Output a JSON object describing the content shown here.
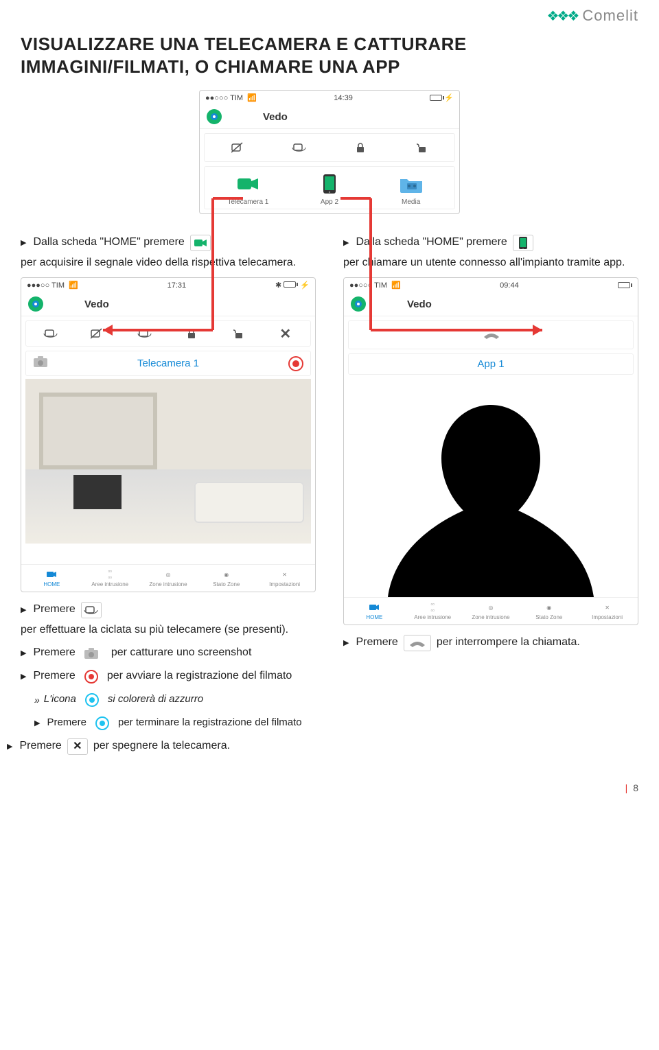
{
  "brand": "Comelit",
  "section_title": "VISUALIZZARE UNA TELECAMERA E CATTURARE IMMAGINI/FILMATI, O CHIAMARE UNA APP",
  "top_phone": {
    "carrier": "TIM",
    "time": "14:39",
    "title": "Vedo",
    "items": [
      "Telecamera 1",
      "App 2",
      "Media"
    ]
  },
  "left": {
    "intro_parts": [
      "Dalla scheda \"HOME\" premere",
      "per acquisire il segnale video della rispettiva telecamera."
    ],
    "phone": {
      "carrier": "TIM",
      "time": "17:31",
      "title": "Vedo",
      "cam_name": "Telecamera 1",
      "nav": [
        "HOME",
        "Aree intrusione",
        "Zone intrusione",
        "Stato Zone",
        "Impostazioni"
      ]
    },
    "bullet1": [
      "Premere",
      "per effettuare la ciclata su più telecamere (se presenti)."
    ],
    "bullet2": [
      "Premere",
      "per catturare uno screenshot"
    ],
    "bullet3": [
      "Premere",
      "per avviare la registrazione del filmato"
    ],
    "sub1": [
      "L'icona",
      "si colorerà di azzurro"
    ],
    "sub2": [
      "Premere",
      "per terminare la registrazione del filmato"
    ],
    "bullet4": [
      "Premere",
      "per spegnere la telecamera."
    ]
  },
  "right": {
    "intro_parts": [
      "Dalla scheda \"HOME\" premere",
      "per chiamare un utente connesso all'impianto tramite app."
    ],
    "phone": {
      "carrier": "TIM",
      "time": "09:44",
      "title": "Vedo",
      "app_name": "App 1",
      "nav": [
        "HOME",
        "Aree intrusione",
        "Zone intrusione",
        "Stato Zone",
        "Impostazioni"
      ]
    },
    "bullet1": [
      "Premere",
      "per interrompere la chiamata."
    ]
  },
  "page_number": "8"
}
